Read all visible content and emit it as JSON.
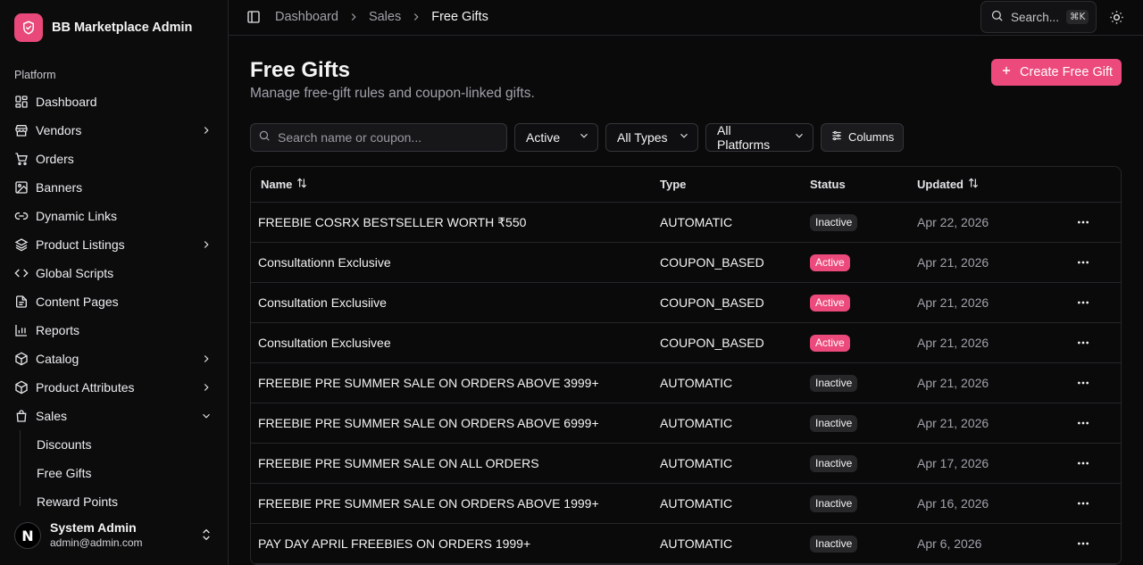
{
  "brand": {
    "name": "BB Marketplace Admin",
    "icon": "shield-icon"
  },
  "sidebar": {
    "group_label": "Platform",
    "items": [
      {
        "label": "Dashboard",
        "icon": "dashboard-icon"
      },
      {
        "label": "Vendors",
        "icon": "store-icon",
        "chevron": "right"
      },
      {
        "label": "Orders",
        "icon": "cart-icon"
      },
      {
        "label": "Banners",
        "icon": "image-icon"
      },
      {
        "label": "Dynamic Links",
        "icon": "link-icon"
      },
      {
        "label": "Product Listings",
        "icon": "layers-icon",
        "chevron": "right"
      },
      {
        "label": "Global Scripts",
        "icon": "code-icon"
      },
      {
        "label": "Content Pages",
        "icon": "file-icon"
      },
      {
        "label": "Reports",
        "icon": "bar-chart-icon"
      },
      {
        "label": "Catalog",
        "icon": "box-icon",
        "chevron": "right"
      },
      {
        "label": "Product Attributes",
        "icon": "box-icon",
        "chevron": "right"
      },
      {
        "label": "Sales",
        "icon": "shopping-bag-icon",
        "chevron": "down"
      }
    ],
    "sales_sub": [
      "Discounts",
      "Free Gifts",
      "Reward Points"
    ]
  },
  "user": {
    "initial": "N",
    "name": "System Admin",
    "email": "admin@admin.com"
  },
  "topbar": {
    "breadcrumbs": [
      "Dashboard",
      "Sales",
      "Free Gifts"
    ],
    "search_label": "Search...",
    "search_shortcut": "⌘K"
  },
  "page": {
    "title": "Free Gifts",
    "subtitle": "Manage free-gift rules and coupon-linked gifts.",
    "create_label": "Create Free Gift"
  },
  "filters": {
    "search_placeholder": "Search name or coupon...",
    "status": "Active",
    "type": "All Types",
    "platform": "All Platforms",
    "columns_label": "Columns"
  },
  "table": {
    "headers": {
      "name": "Name",
      "type": "Type",
      "status": "Status",
      "updated": "Updated"
    },
    "rows": [
      {
        "name": "FREEBIE COSRX BESTSELLER WORTH ₹550",
        "type": "AUTOMATIC",
        "status": "Inactive",
        "updated": "Apr 22, 2026"
      },
      {
        "name": "Consultationn Exclusive",
        "type": "COUPON_BASED",
        "status": "Active",
        "updated": "Apr 21, 2026"
      },
      {
        "name": "Consultation Exclusiive",
        "type": "COUPON_BASED",
        "status": "Active",
        "updated": "Apr 21, 2026"
      },
      {
        "name": "Consultation Exclusivee",
        "type": "COUPON_BASED",
        "status": "Active",
        "updated": "Apr 21, 2026"
      },
      {
        "name": "FREEBIE PRE SUMMER SALE ON ORDERS ABOVE 3999+",
        "type": "AUTOMATIC",
        "status": "Inactive",
        "updated": "Apr 21, 2026"
      },
      {
        "name": "FREEBIE PRE SUMMER SALE ON ORDERS ABOVE 6999+",
        "type": "AUTOMATIC",
        "status": "Inactive",
        "updated": "Apr 21, 2026"
      },
      {
        "name": "FREEBIE PRE SUMMER SALE ON ALL ORDERS",
        "type": "AUTOMATIC",
        "status": "Inactive",
        "updated": "Apr 17, 2026"
      },
      {
        "name": "FREEBIE PRE SUMMER SALE ON ORDERS ABOVE 1999+",
        "type": "AUTOMATIC",
        "status": "Inactive",
        "updated": "Apr 16, 2026"
      },
      {
        "name": "PAY DAY APRIL FREEBIES ON ORDERS 1999+",
        "type": "AUTOMATIC",
        "status": "Inactive",
        "updated": "Apr 6, 2026"
      }
    ]
  },
  "colors": {
    "accent": "#ec4a7c",
    "background": "#0a0a0b",
    "border": "#26262a"
  }
}
